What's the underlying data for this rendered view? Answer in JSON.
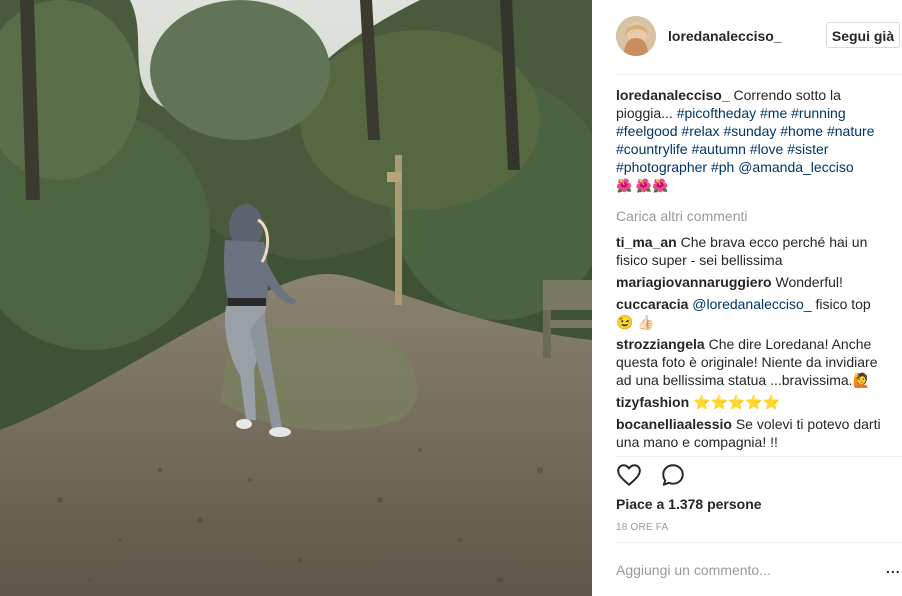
{
  "header": {
    "username": "loredanalecciso_",
    "follow_label": "Segui già"
  },
  "caption": {
    "user": "loredanalecciso_",
    "text": "Correndo sotto la pioggia...",
    "hashtags": [
      "#picoftheday",
      "#me",
      "#running",
      "#feelgood",
      "#relax",
      "#sunday",
      "#home",
      "#nature",
      "#countrylife",
      "#autumn",
      "#love",
      "#sister",
      "#photographer",
      "#ph"
    ],
    "mention": "@amanda_lecciso",
    "emoji": "🌺 🌺🌺"
  },
  "load_more_label": "Carica altri commenti",
  "comments": [
    {
      "user": "ti_ma_an",
      "text": "Che brava ecco perché hai un fisico super - sei bellissima"
    },
    {
      "user": "mariagiovannaruggiero",
      "text": "Wonderful!"
    },
    {
      "user": "cuccaracia",
      "mention": "@loredanalecciso_",
      "text": "fisico top 😉 👍🏻"
    },
    {
      "user": "strozziangela",
      "text": "Che dire Loredana! Anche questa foto è originale! Niente da invidiare ad una bellissima statua ...bravissima.🙋"
    },
    {
      "user": "tizyfashion",
      "text": "⭐⭐⭐⭐⭐"
    },
    {
      "user": "bocanelliaalessio",
      "text": "Se volevi ti potevo darti una mano e compagnia! !!"
    }
  ],
  "actions": {
    "like_icon": "heart-icon",
    "comment_icon": "speech-bubble-icon"
  },
  "likes_label": "Piace a 1.378 persone",
  "time_label": "18 ORE FA",
  "add_comment_placeholder": "Aggiungi un commento...",
  "more_label": "..."
}
